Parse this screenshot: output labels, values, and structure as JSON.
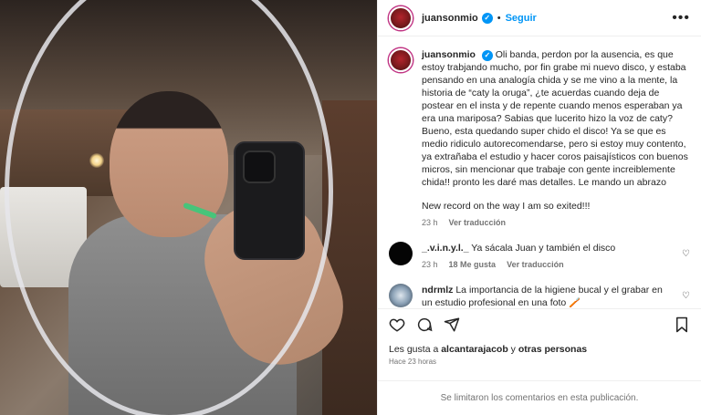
{
  "post": {
    "author": "juansonmio",
    "follow_label": "Seguir",
    "more_label": "•••",
    "dot": "•"
  },
  "caption": {
    "author": "juansonmio",
    "text": "Oli banda, perdon por la ausencia, es que estoy trabjando mucho, por fin grabe mi nuevo disco, y estaba pensando en una analogía chida y se me vino a la mente, la historia de “caty la oruga”, ¿te acuerdas cuando deja de postear en el insta y de repente cuando menos esperaban ya era una mariposa? Sabias que lucerito hizo la voz de caty? Bueno, esta quedando super chido el disco! Ya se que es medio ridiculo autorecomendarse, pero si estoy muy contento, ya extrañaba el estudio y hacer coros paisajísticos con buenos micros, sin mencionar que trabaje con gente increiblemente chida!! pronto les daré mas detalles. Le mando un abrazo",
    "text2": "New record on the way I am so exited!!!",
    "time": "23 h",
    "translate": "Ver traducción"
  },
  "comments": [
    {
      "author": "_.v.i.n.y.l._",
      "text": "Ya sácala Juan y también el disco",
      "time": "23 h",
      "likes": "18 Me gusta",
      "translate": "Ver traducción"
    },
    {
      "author": "ndrmlz",
      "text": "La importancia de la higiene bucal y el grabar en un estudio profesional en una foto 🪥"
    }
  ],
  "likes": {
    "prefix": "Les gusta a ",
    "user": "alcantarajacob",
    "conj": " y ",
    "others": "otras personas"
  },
  "posted": "Hace 23 horas",
  "footer": "Se limitaron los comentarios en esta publicación.",
  "colors": {
    "accent": "#0095f6",
    "muted": "#737373",
    "text": "#262626"
  }
}
